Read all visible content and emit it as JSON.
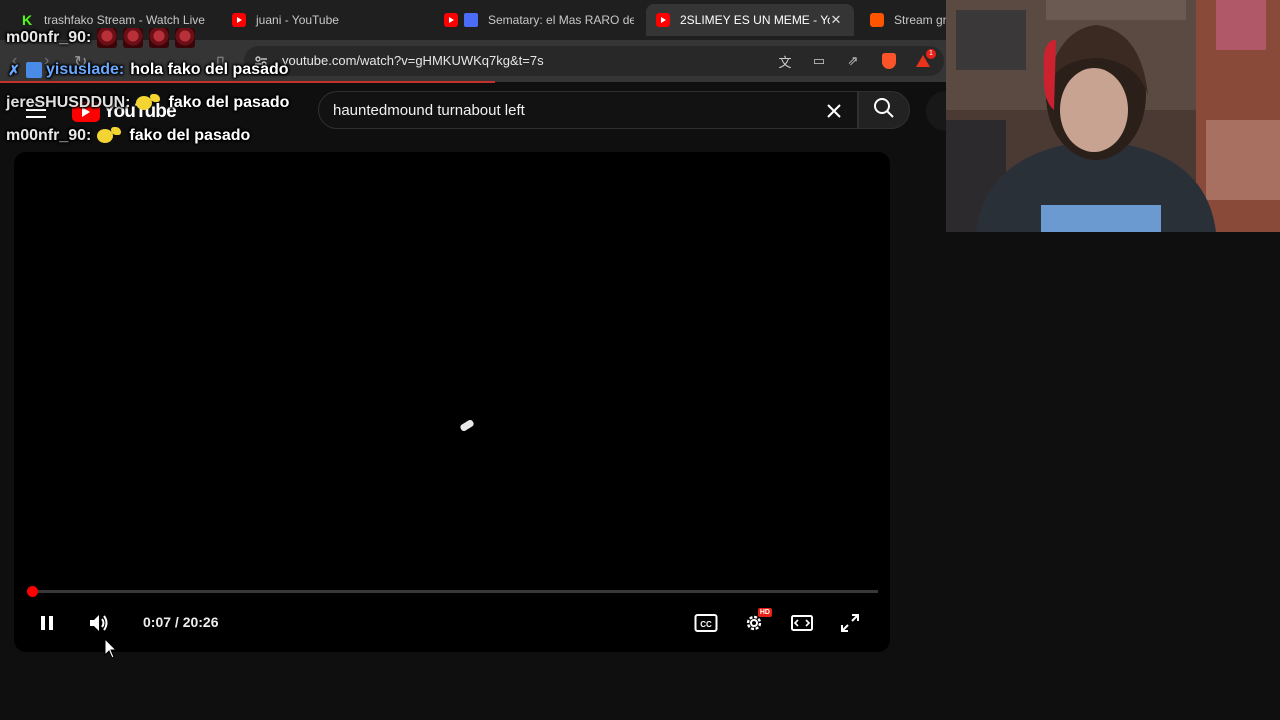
{
  "browser": {
    "tabs": [
      {
        "title": "trashfako Stream - Watch Live",
        "favicon": "kick-icon",
        "active": false
      },
      {
        "title": "juani - YouTube",
        "favicon": "youtube-icon",
        "active": false
      },
      {
        "title": "Sematary: el Mas RARO de",
        "favicon": "youtube-icon",
        "active": false
      },
      {
        "title": "2SLIMEY ES UN MEME - Yo",
        "favicon": "youtube-icon",
        "active": true
      },
      {
        "title": "Stream gr",
        "favicon": "soundcloud-icon",
        "active": false
      }
    ],
    "url": "youtube.com/watch?v=gHMKUWKq7kg&t=7s",
    "extension_badge": "1"
  },
  "youtube": {
    "logo_text": "YouTube",
    "search_value": "hauntedmound turnabout left"
  },
  "player": {
    "current_time": "0:07",
    "duration": "20:26",
    "time_display": "0:07 / 20:26",
    "progress_fraction": 0.0057,
    "hd_badge": "HD",
    "accent_color": "#ff0000"
  },
  "chat": [
    {
      "user": "m00nfr_90:",
      "message": "",
      "emotes": 4
    },
    {
      "user": "yisuslade:",
      "message": "hola fako del pasado"
    },
    {
      "user": "jereSHUSDDUN:",
      "message": "fako del pasado"
    },
    {
      "user": "m00nfr_90:",
      "message": "fako del pasado"
    }
  ]
}
